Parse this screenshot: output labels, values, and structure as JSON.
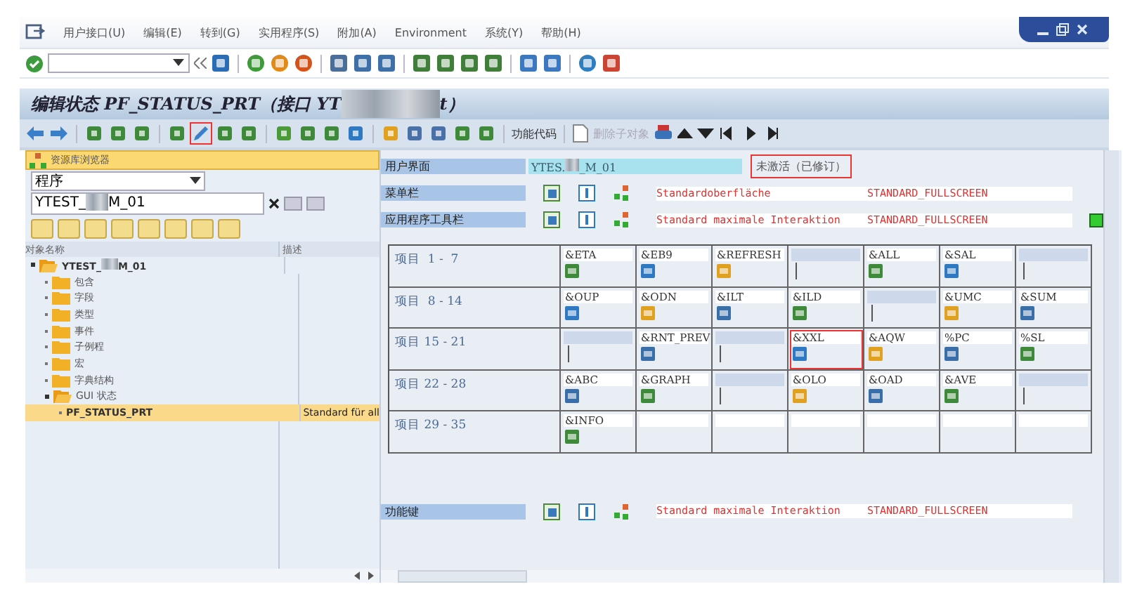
{
  "menu": [
    "用户接口(U)",
    "编辑(E)",
    "转到(G)",
    "实用程序(S)",
    "附加(A)",
    "Environment",
    "系统(Y)",
    "帮助(H)"
  ],
  "title": {
    "parts": [
      "编辑状态 PF_STATUS_PRT（接口 YT",
      "t）"
    ]
  },
  "app_toolbar": {
    "function_code": "功能代码",
    "delete_subobject": {
      "label": "删除子对象",
      "disabled": true
    },
    "highlighted_tool": true
  },
  "browser": {
    "header": "资源库浏览器",
    "object_type": "程序",
    "object_parts": [
      "YTEST_",
      "M_01"
    ],
    "columns": [
      "对象名称",
      "描述"
    ],
    "tree": [
      {
        "name_parts": [
          "YTEST_",
          "M_01"
        ],
        "expanded": true,
        "selected": false,
        "children": [
          {
            "name": "包含",
            "expanded": false,
            "selected": false
          },
          {
            "name": "字段",
            "expanded": false,
            "selected": false
          },
          {
            "name": "类型",
            "expanded": false,
            "selected": false
          },
          {
            "name": "事件",
            "expanded": false,
            "selected": false
          },
          {
            "name": "子例程",
            "expanded": false,
            "selected": false
          },
          {
            "name": "宏",
            "expanded": false,
            "selected": false
          },
          {
            "name": "字典结构",
            "expanded": false,
            "selected": false
          },
          {
            "name": "GUI 状态",
            "expanded": true,
            "selected": false,
            "children": [
              {
                "name": "PF_STATUS_PRT",
                "description": "Standard für all",
                "selected": true
              }
            ]
          }
        ]
      }
    ]
  },
  "status_panel": {
    "user_interface": {
      "label": "用户界面",
      "value_parts": [
        "YTES.",
        "_M_01"
      ],
      "status": "未激活（已修订）"
    },
    "bars": [
      {
        "label": "菜单栏",
        "text": "Standardoberfläche",
        "code": "STANDARD_FULLSCREEN",
        "indicator": false
      },
      {
        "label": "应用程序工具栏",
        "text": "Standard maximale Interaktion",
        "code": "STANDARD_FULLSCREEN",
        "indicator": true
      }
    ],
    "items": [
      {
        "label": "项目  1 -  7",
        "cells": [
          {
            "kind": "function",
            "code": "&ETA"
          },
          {
            "kind": "function",
            "code": "&EB9"
          },
          {
            "kind": "function",
            "code": "&REFRESH"
          },
          {
            "kind": "separator"
          },
          {
            "kind": "function",
            "code": "&ALL"
          },
          {
            "kind": "function",
            "code": "&SAL"
          },
          {
            "kind": "separator"
          }
        ]
      },
      {
        "label": "项目  8 - 14",
        "cells": [
          {
            "kind": "function",
            "code": "&OUP"
          },
          {
            "kind": "function",
            "code": "&ODN"
          },
          {
            "kind": "function",
            "code": "&ILT"
          },
          {
            "kind": "function",
            "code": "&ILD"
          },
          {
            "kind": "separator"
          },
          {
            "kind": "function",
            "code": "&UMC"
          },
          {
            "kind": "function",
            "code": "&SUM"
          }
        ]
      },
      {
        "label": "项目 15 - 21",
        "cells": [
          {
            "kind": "separator"
          },
          {
            "kind": "function",
            "code": "&RNT_PREV"
          },
          {
            "kind": "separator"
          },
          {
            "kind": "function",
            "code": "&XXL",
            "highlighted": true
          },
          {
            "kind": "function",
            "code": "&AQW"
          },
          {
            "kind": "function",
            "code": "%PC"
          },
          {
            "kind": "function",
            "code": "%SL"
          }
        ]
      },
      {
        "label": "项目 22 - 28",
        "cells": [
          {
            "kind": "function",
            "code": "&ABC"
          },
          {
            "kind": "function",
            "code": "&GRAPH"
          },
          {
            "kind": "separator"
          },
          {
            "kind": "function",
            "code": "&OLO"
          },
          {
            "kind": "function",
            "code": "&OAD"
          },
          {
            "kind": "function",
            "code": "&AVE"
          },
          {
            "kind": "separator"
          }
        ]
      },
      {
        "label": "项目 29 - 35",
        "cells": [
          {
            "kind": "function",
            "code": "&INFO"
          },
          {
            "kind": "empty"
          },
          {
            "kind": "empty"
          },
          {
            "kind": "empty"
          },
          {
            "kind": "empty"
          },
          {
            "kind": "empty"
          },
          {
            "kind": "empty"
          }
        ]
      }
    ],
    "function_keys": {
      "label": "功能键",
      "text": "Standard maximale Interaktion",
      "code": "STANDARD_FULLSCREEN"
    }
  }
}
